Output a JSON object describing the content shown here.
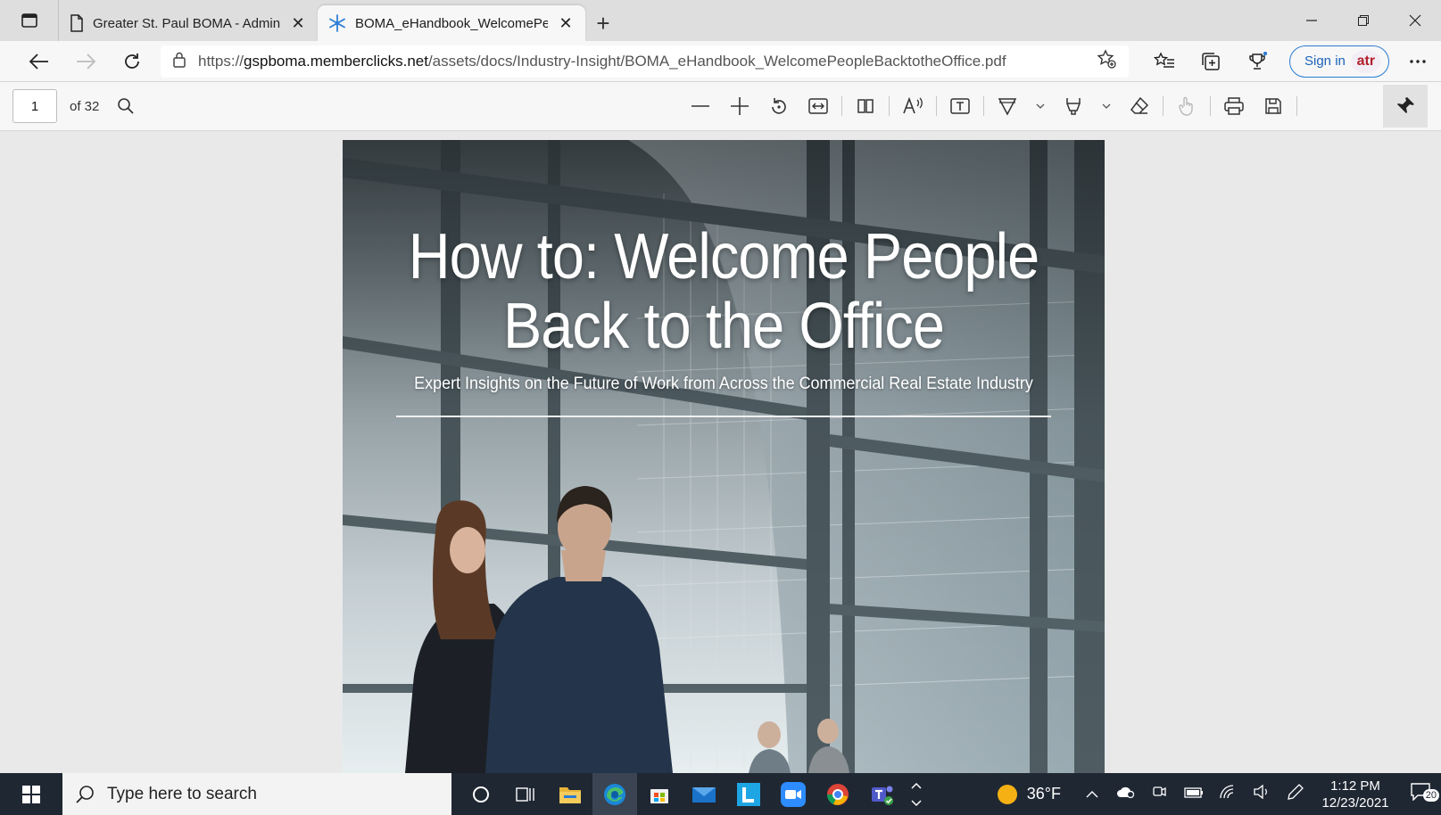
{
  "browser": {
    "tabs": [
      {
        "title": "Greater St. Paul BOMA - Adminis",
        "icon": "page-icon",
        "close": "✕"
      },
      {
        "title": "BOMA_eHandbook_WelcomePeo",
        "icon": "snowflake-icon",
        "close": "✕"
      }
    ],
    "new_tab": "+",
    "address": {
      "prefix": "https://",
      "host": "gspboma.memberclicks.net",
      "path": "/assets/docs/Industry-Insight/BOMA_eHandbook_WelcomePeopleBacktotheOffice.pdf"
    },
    "sign_in": "Sign in",
    "avatar_text": "atr"
  },
  "pdf_toolbar": {
    "page_number": "1",
    "of_pages": "of 32"
  },
  "document": {
    "title_line1": "How to: Welcome People",
    "title_line2": "Back to the Office",
    "subtitle": "Expert Insights on the Future of Work from Across the Commercial Real Estate Industry"
  },
  "taskbar": {
    "search_placeholder": "Type here to search",
    "weather": "36°F",
    "time": "1:12 PM",
    "date": "12/23/2021",
    "notification_count": "20"
  },
  "colors": {
    "accent": "#2b7cd3",
    "taskbar": "#1f2733"
  }
}
